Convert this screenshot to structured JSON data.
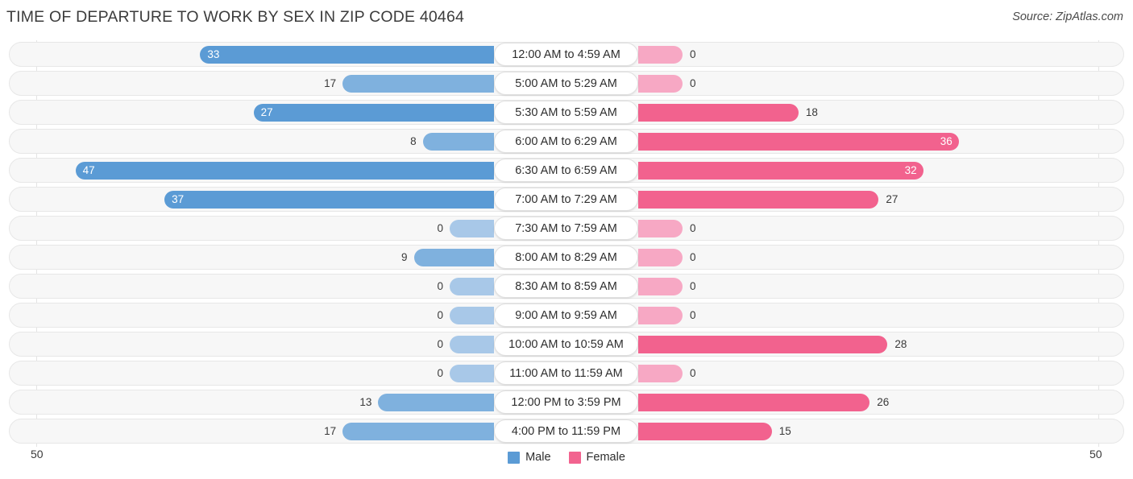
{
  "header": {
    "title": "TIME OF DEPARTURE TO WORK BY SEX IN ZIP CODE 40464",
    "source": "Source: ZipAtlas.com"
  },
  "axis": {
    "left_tick": "50",
    "right_tick": "50"
  },
  "legend": {
    "items": [
      {
        "label": "Male",
        "color": "#5b9bd5"
      },
      {
        "label": "Female",
        "color": "#f2638f"
      }
    ]
  },
  "colors": {
    "male_strong": "#5b9bd5",
    "male_light": "#a8c8e8",
    "female_strong": "#f2628e",
    "female_light": "#f7a8c4",
    "track_bg": "#f7f7f7",
    "track_border": "#e7e7e7",
    "gridline": "#e4e4e4"
  },
  "chart_data": {
    "type": "bar",
    "orientation": "horizontal-diverging",
    "title": "TIME OF DEPARTURE TO WORK BY SEX IN ZIP CODE 40464",
    "xlabel": "",
    "ylabel": "",
    "xlim": [
      50,
      50
    ],
    "grid": true,
    "legend_position": "bottom-center",
    "categories": [
      "12:00 AM to 4:59 AM",
      "5:00 AM to 5:29 AM",
      "5:30 AM to 5:59 AM",
      "6:00 AM to 6:29 AM",
      "6:30 AM to 6:59 AM",
      "7:00 AM to 7:29 AM",
      "7:30 AM to 7:59 AM",
      "8:00 AM to 8:29 AM",
      "8:30 AM to 8:59 AM",
      "9:00 AM to 9:59 AM",
      "10:00 AM to 10:59 AM",
      "11:00 AM to 11:59 AM",
      "12:00 PM to 3:59 PM",
      "4:00 PM to 11:59 PM"
    ],
    "series": [
      {
        "name": "Male",
        "color": "#5b9bd5",
        "values": [
          33,
          17,
          27,
          8,
          47,
          37,
          0,
          9,
          0,
          0,
          0,
          0,
          13,
          17
        ]
      },
      {
        "name": "Female",
        "color": "#f2628e",
        "values": [
          0,
          0,
          18,
          36,
          32,
          27,
          0,
          0,
          0,
          0,
          28,
          0,
          26,
          15
        ]
      }
    ]
  },
  "rows": [
    {
      "category": "12:00 AM to 4:59 AM",
      "male": "33",
      "female": "0"
    },
    {
      "category": "5:00 AM to 5:29 AM",
      "male": "17",
      "female": "0"
    },
    {
      "category": "5:30 AM to 5:59 AM",
      "male": "27",
      "female": "18"
    },
    {
      "category": "6:00 AM to 6:29 AM",
      "male": "8",
      "female": "36"
    },
    {
      "category": "6:30 AM to 6:59 AM",
      "male": "47",
      "female": "32"
    },
    {
      "category": "7:00 AM to 7:29 AM",
      "male": "37",
      "female": "27"
    },
    {
      "category": "7:30 AM to 7:59 AM",
      "male": "0",
      "female": "0"
    },
    {
      "category": "8:00 AM to 8:29 AM",
      "male": "9",
      "female": "0"
    },
    {
      "category": "8:30 AM to 8:59 AM",
      "male": "0",
      "female": "0"
    },
    {
      "category": "9:00 AM to 9:59 AM",
      "male": "0",
      "female": "0"
    },
    {
      "category": "10:00 AM to 10:59 AM",
      "male": "0",
      "female": "28"
    },
    {
      "category": "11:00 AM to 11:59 AM",
      "male": "0",
      "female": "0"
    },
    {
      "category": "12:00 PM to 3:59 PM",
      "male": "13",
      "female": "26"
    },
    {
      "category": "4:00 PM to 11:59 PM",
      "male": "17",
      "female": "15"
    }
  ]
}
